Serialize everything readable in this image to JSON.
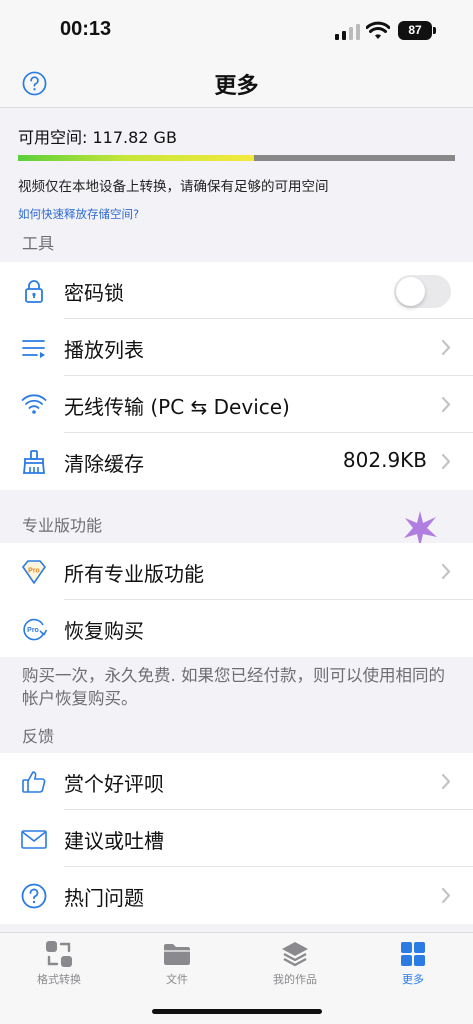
{
  "status_bar": {
    "time": "00:13",
    "battery": "87"
  },
  "nav": {
    "title": "更多"
  },
  "storage": {
    "label": "可用空间: 117.82 GB",
    "used_fraction": 0.54,
    "note": "视频仅在本地设备上转换，请确保有足够的可用空间",
    "link": "如何快速释放存储空间?"
  },
  "tools": {
    "header": "工具",
    "items": [
      {
        "label": "密码锁",
        "toggle_on": false
      },
      {
        "label": "播放列表"
      },
      {
        "label": "无线传输 (PC ⇆ Device)"
      },
      {
        "label": "清除缓存",
        "value": "802.9KB"
      }
    ]
  },
  "pro": {
    "header": "专业版功能",
    "items": [
      {
        "label": "所有专业版功能"
      },
      {
        "label": "恢复购买"
      }
    ],
    "note": "购买一次，永久免费. 如果您已经付款，则可以使用相同的帐户恢复购买。"
  },
  "feedback": {
    "header": "反馈",
    "items": [
      {
        "label": "赏个好评呗"
      },
      {
        "label": "建议或吐槽"
      },
      {
        "label": "热门问题"
      }
    ]
  },
  "tabs": [
    {
      "label": "格式转换",
      "icon": "convert-icon",
      "active": false
    },
    {
      "label": "文件",
      "icon": "folder-icon",
      "active": false
    },
    {
      "label": "我的作品",
      "icon": "layers-icon",
      "active": false
    },
    {
      "label": "更多",
      "icon": "grid-icon",
      "active": true
    }
  ],
  "colors": {
    "accent": "#2a7be4",
    "link": "#2d6ad0",
    "toggle_off": "#e9e9eb"
  }
}
